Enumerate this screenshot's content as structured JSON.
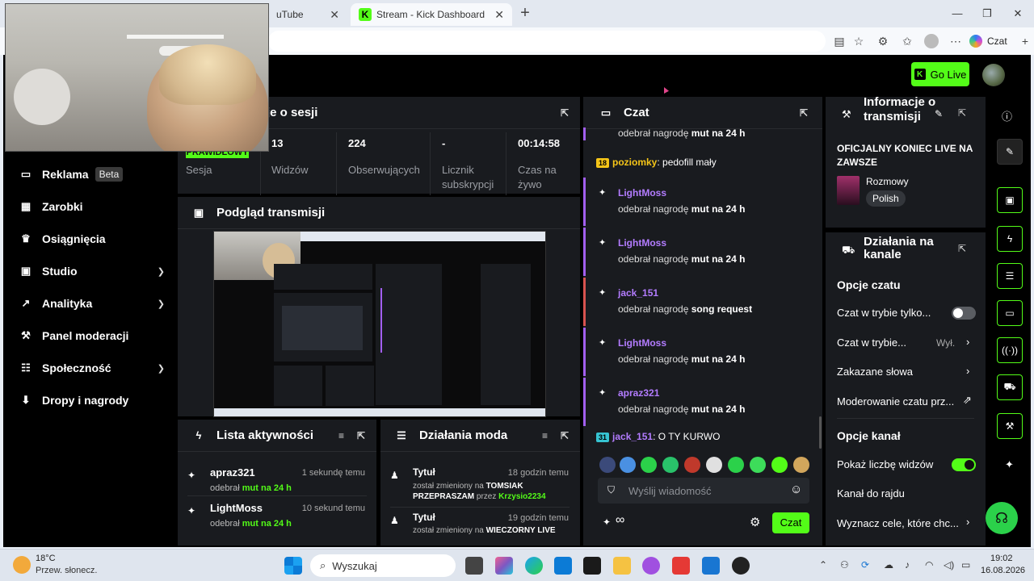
{
  "browser": {
    "tabs": [
      {
        "label": "uTube"
      },
      {
        "label": "Stream - Kick Dashboard",
        "active": true
      }
    ],
    "copilot_label": "Czat"
  },
  "header": {
    "go_live_label": "Go Live"
  },
  "sidebar": {
    "items": [
      {
        "label": "Reklama",
        "badge": "Beta"
      },
      {
        "label": "Zarobki"
      },
      {
        "label": "Osiągnięcia"
      },
      {
        "label": "Studio",
        "expandable": true
      },
      {
        "label": "Analityka",
        "expandable": true
      },
      {
        "label": "Panel moderacji"
      },
      {
        "label": "Społeczność",
        "expandable": true
      },
      {
        "label": "Dropy i nagrody"
      }
    ]
  },
  "session": {
    "title_fragment": "je o sesji",
    "status_badge": "PRAWIDŁOWY",
    "status_label": "Sesja",
    "stats": [
      {
        "value": "13",
        "label": "Widzów"
      },
      {
        "value": "224",
        "label": "Obserwujących"
      },
      {
        "value": "-",
        "label": "Licznik subskrypcji"
      },
      {
        "value": "00:14:58",
        "label": "Czas na żywo"
      }
    ]
  },
  "preview": {
    "title": "Podgląd transmisji"
  },
  "activity": {
    "title": "Lista aktywności",
    "items": [
      {
        "name": "apraz321",
        "time": "1 sekundę temu",
        "prefix": "odebrał",
        "reward": "mut na 24 h"
      },
      {
        "name": "LightMoss",
        "time": "10 sekund temu",
        "prefix": "odebrał",
        "reward": "mut na 24 h"
      }
    ]
  },
  "modactions": {
    "title": "Działania moda",
    "items": [
      {
        "name": "Tytuł",
        "time": "18 godzin temu",
        "text1": "został zmieniony na",
        "value": "TOMSIAK PRZEPRASZAM",
        "by": "przez",
        "mod": "Krzysio2234"
      },
      {
        "name": "Tytuł",
        "time": "19 godzin temu",
        "text1": "został zmieniony na",
        "value": "WIECZORNY LIVE"
      }
    ]
  },
  "chat": {
    "title": "Czat",
    "top_fragment": "odebrał nagrodę",
    "top_reward": "mut na 24 h",
    "messages": [
      {
        "badge": "18",
        "user": "poziomky",
        "text": ": pedofill mały"
      },
      {
        "user": "LightMoss",
        "prefix": "odebrał nagrodę",
        "reward": "mut na 24 h"
      },
      {
        "user": "LightMoss",
        "prefix": "odebrał nagrodę",
        "reward": "mut na 24 h"
      },
      {
        "user": "jack_151",
        "prefix": "odebrał nagrodę",
        "reward": "song request"
      },
      {
        "user": "LightMoss",
        "prefix": "odebrał nagrodę",
        "reward": "mut na 24 h"
      },
      {
        "user": "apraz321",
        "prefix": "odebrał nagrodę",
        "reward": "mut na 24 h"
      },
      {
        "badge": "31",
        "user": "jack_151",
        "text": ": O TY KURWO"
      }
    ],
    "input_placeholder": "Wyślij wiadomość",
    "send_label": "Czat",
    "infinity": "∞"
  },
  "info": {
    "title": "Informacje o transmisji",
    "stream_title": "OFICJALNY KONIEC LIVE NA ZAWSZE",
    "category": "Rozmowy",
    "language": "Polish"
  },
  "channel": {
    "title": "Działania na kanale",
    "chat_section": "Opcje czatu",
    "rows": [
      {
        "label": "Czat w trybie tylko...",
        "control": "toggle-off"
      },
      {
        "label": "Czat w trybie...",
        "value": "Wył.",
        "control": "chevron"
      },
      {
        "label": "Zakazane słowa",
        "control": "chevron"
      },
      {
        "label": "Moderowanie czatu prz...",
        "control": "external"
      }
    ],
    "channel_section": "Opcje kanał",
    "rows2": [
      {
        "label": "Pokaż liczbę widzów",
        "control": "toggle-on"
      },
      {
        "label": "Kanał do rajdu"
      },
      {
        "label": "Wyznacz cele, które chc...",
        "control": "chevron"
      }
    ]
  },
  "taskbar": {
    "weather_temp": "18°C",
    "weather_desc": "Przew. słonecz.",
    "search_placeholder": "Wyszukaj",
    "time": "19:02",
    "date": "16.08.2026"
  },
  "colors": {
    "accent": "#53fc18",
    "panel": "#191b1f",
    "purple": "#b37cff"
  }
}
